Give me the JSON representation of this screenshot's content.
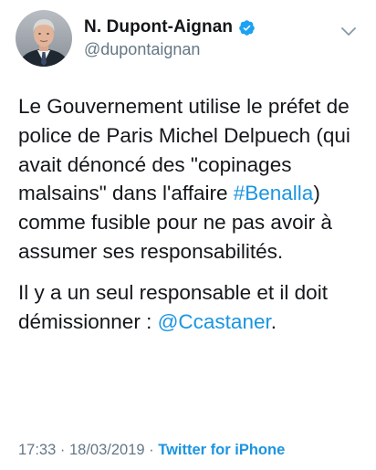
{
  "author": {
    "display_name": "N. Dupont-Aignan",
    "handle": "@dupontaignan",
    "verified": true,
    "avatar_icon": "profile-photo"
  },
  "tweet": {
    "paragraph1": {
      "text_before": "Le Gouvernement utilise le préfet de police de Paris Michel Delpuech (qui avait dénoncé des \"copinages malsains\" dans l'affaire ",
      "hashtag": "#Benalla",
      "text_after": ") comme fusible pour ne pas avoir à assumer ses responsabilités."
    },
    "paragraph2": {
      "text_before": "Il y a un seul responsable et il doit démissionner : ",
      "mention": "@Ccastaner",
      "text_after": "."
    }
  },
  "meta": {
    "time": "17:33",
    "separator1": " · ",
    "date": "18/03/2019",
    "separator2": " · ",
    "source": "Twitter for iPhone"
  },
  "colors": {
    "text": "#14171a",
    "secondary": "#657786",
    "link": "#1b95e0",
    "verified_badge": "#1da1f2"
  },
  "icons": {
    "verified": "verified-badge-icon",
    "menu": "chevron-down-icon"
  }
}
